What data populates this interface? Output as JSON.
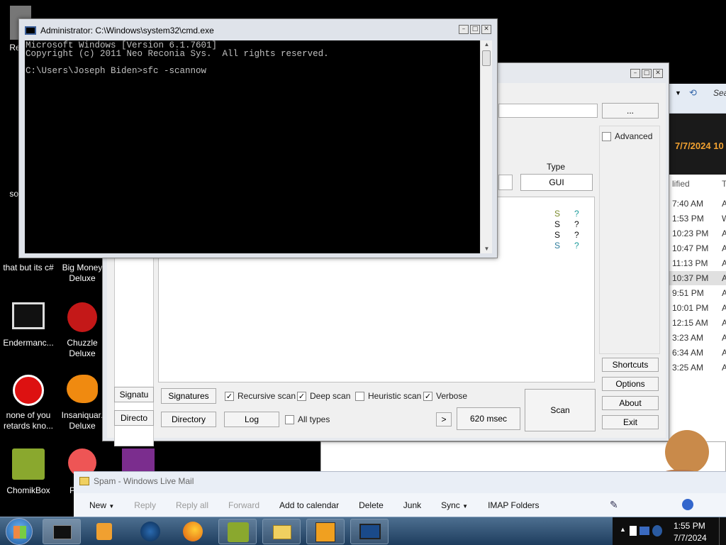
{
  "desktop_icons": [
    {
      "label": "Rec",
      "x": 0
    },
    {
      "label": "somra",
      "x": 0
    },
    {
      "label": "that but its c#",
      "x": 0
    },
    {
      "label": "Big Money Deluxe",
      "x": 0
    },
    {
      "label": "Endermanc...",
      "x": 0
    },
    {
      "label": "Chuzzle Deluxe",
      "x": 0
    },
    {
      "label": "none of you retards kno...",
      "x": 0
    },
    {
      "label": "Insaniquar. Deluxe",
      "x": 0
    },
    {
      "label": "ChomikBox",
      "x": 0
    },
    {
      "label": "Pege",
      "x": 0
    }
  ],
  "cmd": {
    "title": "Administrator: C:\\Windows\\system32\\cmd.exe",
    "lines": [
      "Microsoft Windows [Version 6.1.7601]",
      "Copyright (c) 2011 Neo Reconia Sys.  All rights reserved.",
      "",
      "C:\\Users\\Joseph Biden>sfc -scannow"
    ]
  },
  "scanner": {
    "browse_label": "...",
    "advanced_label": "Advanced",
    "type_header": "Type",
    "type_value": "GUI",
    "results": [
      {
        "s": "S",
        "q": "?"
      },
      {
        "s": "S",
        "q": "?"
      },
      {
        "s": "S",
        "q": "?"
      },
      {
        "s": "S",
        "q": "?"
      }
    ],
    "left_buttons": [
      "Signatu",
      "Directo"
    ],
    "signatures_label": "Signatures",
    "directory_label": "Directory",
    "log_label": "Log",
    "recursive_label": "Recursive scan",
    "deep_label": "Deep scan",
    "heuristic_label": "Heuristic scan",
    "verbose_label": "Verbose",
    "alltypes_label": "All types",
    "arrow_label": ">",
    "time_label": "620 msec",
    "scan_label": "Scan",
    "side_buttons": [
      "Shortcuts",
      "Options",
      "About",
      "Exit"
    ]
  },
  "explorer": {
    "search_label": "Sea",
    "date_header": "7/7/2024 10",
    "modified_header": "lified",
    "t_header": "T",
    "rows": [
      {
        "time": "7:40 AM",
        "t": "A"
      },
      {
        "time": "1:53 PM",
        "t": "W"
      },
      {
        "time": "10:23 PM",
        "t": "A"
      },
      {
        "time": "10:47 PM",
        "t": "A"
      },
      {
        "time": "11:13 PM",
        "t": "A"
      },
      {
        "time": "10:37 PM",
        "t": "A"
      },
      {
        "time": "9:51 PM",
        "t": "A"
      },
      {
        "time": "10:01 PM",
        "t": "A"
      },
      {
        "time": "12:15 AM",
        "t": "A"
      },
      {
        "time": "3:23 AM",
        "t": "A"
      },
      {
        "time": "6:34 AM",
        "t": "A"
      },
      {
        "time": "3:25 AM",
        "t": "A"
      }
    ]
  },
  "mail": {
    "title": "Spam - Windows Live Mail",
    "toolbar": [
      {
        "label": "New",
        "enabled": true
      },
      {
        "label": "Reply",
        "enabled": false
      },
      {
        "label": "Reply all",
        "enabled": false
      },
      {
        "label": "Forward",
        "enabled": false
      },
      {
        "label": "Add to calendar",
        "enabled": true
      },
      {
        "label": "Delete",
        "enabled": true
      },
      {
        "label": "Junk",
        "enabled": true
      },
      {
        "label": "Sync",
        "enabled": true
      },
      {
        "label": "IMAP Folders",
        "enabled": true
      }
    ]
  },
  "taskbar": {
    "time": "1:55 PM",
    "date": "7/7/2024"
  }
}
